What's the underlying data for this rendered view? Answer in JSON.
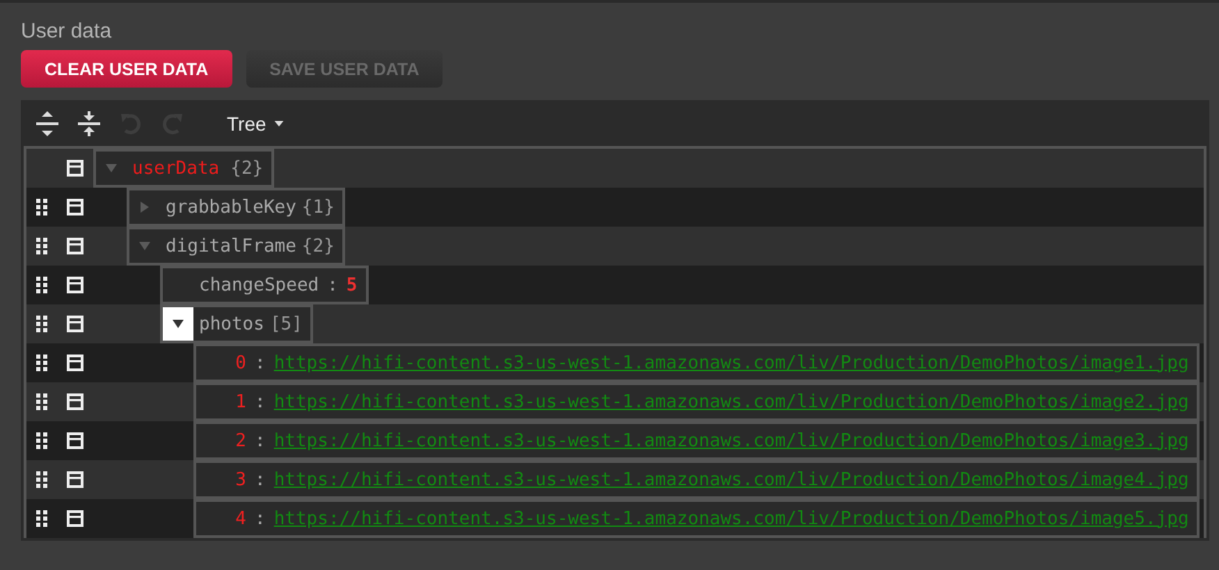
{
  "title": "User data",
  "buttons": [
    {
      "label": "CLEAR USER DATA",
      "disabled": false
    },
    {
      "label": "SAVE USER DATA",
      "disabled": true
    }
  ],
  "toolbar": {
    "mode": "Tree"
  },
  "tree": [
    {
      "key": "userData",
      "kind": "object",
      "count": "{2}",
      "expanded": true,
      "focused": false,
      "children": [
        {
          "key": "grabbableKey",
          "kind": "object",
          "count": "{1}",
          "expanded": false,
          "focused": false
        },
        {
          "key": "digitalFrame",
          "kind": "object",
          "count": "{2}",
          "expanded": true,
          "focused": false,
          "children": [
            {
              "key": "changeSpeed",
              "kind": "number",
              "separator": ":",
              "value": "5"
            },
            {
              "key": "photos",
              "kind": "array",
              "count": "[5]",
              "expanded": true,
              "focused": true,
              "children": [
                {
                  "key": "0",
                  "kind": "url",
                  "separator": ":",
                  "value": "https://hifi-content.s3-us-west-1.amazonaws.com/liv/Production/DemoPhotos/image1.jpg"
                },
                {
                  "key": "1",
                  "kind": "url",
                  "separator": ":",
                  "value": "https://hifi-content.s3-us-west-1.amazonaws.com/liv/Production/DemoPhotos/image2.jpg"
                },
                {
                  "key": "2",
                  "kind": "url",
                  "separator": ":",
                  "value": "https://hifi-content.s3-us-west-1.amazonaws.com/liv/Production/DemoPhotos/image3.jpg"
                },
                {
                  "key": "3",
                  "kind": "url",
                  "separator": ":",
                  "value": "https://hifi-content.s3-us-west-1.amazonaws.com/liv/Production/DemoPhotos/image4.jpg"
                },
                {
                  "key": "4",
                  "kind": "url",
                  "separator": ":",
                  "value": "https://hifi-content.s3-us-west-1.amazonaws.com/liv/Production/DemoPhotos/image5.jpg"
                }
              ]
            }
          ]
        }
      ]
    }
  ]
}
